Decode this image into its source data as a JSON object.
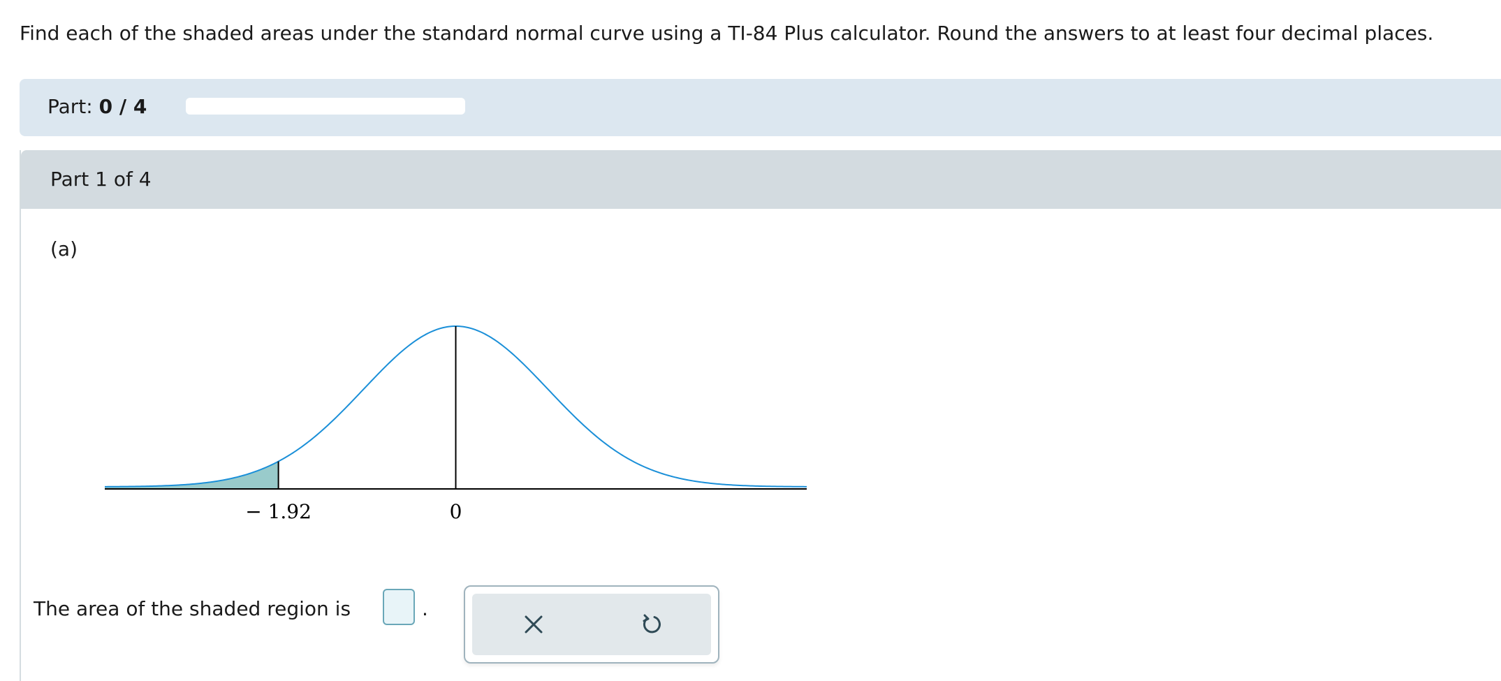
{
  "question": "Find each of the shaded areas under the standard normal curve using a TI-84 Plus calculator. Round the answers to at least four decimal places.",
  "progress": {
    "label": "Part:",
    "value": "0 / 4",
    "completed": 0,
    "total": 4
  },
  "part": {
    "title": "Part 1 of 4",
    "sub_label": "(a)"
  },
  "plot": {
    "tick_labels": [
      "− 1.92",
      "0"
    ],
    "shaded_below_z": -1.92,
    "center_z": 0,
    "colors": {
      "curve": "#1a8fd8",
      "shade": "#99cbcb",
      "axis": "#000000"
    }
  },
  "answer": {
    "prompt": "The area of the shaded region is",
    "suffix": ".",
    "value": ""
  },
  "tools": {
    "clear_icon": "x-icon",
    "reset_icon": "undo-icon"
  }
}
